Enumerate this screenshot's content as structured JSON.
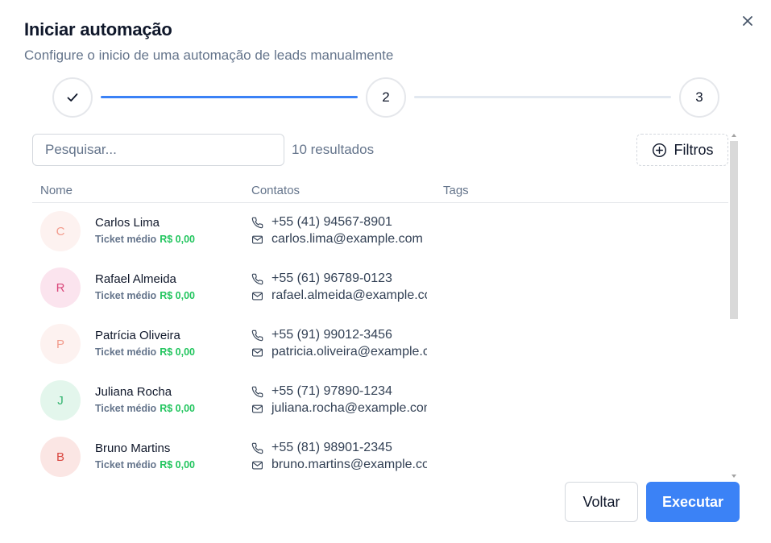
{
  "dialog": {
    "title": "Iniciar automação",
    "subtitle": "Configure o inicio de uma automação de leads manualmente"
  },
  "stepper": {
    "steps": [
      {
        "label": "",
        "state": "completed",
        "icon": "check-icon"
      },
      {
        "label": "2",
        "state": "current"
      },
      {
        "label": "3",
        "state": "upcoming"
      }
    ],
    "active_color": "#3b82f6",
    "inactive_color": "#e2e8f0"
  },
  "toolbar": {
    "search_placeholder": "Pesquisar...",
    "results_text": "10 resultados",
    "filters_label": "Filtros"
  },
  "table": {
    "columns": [
      "Nome",
      "Contatos",
      "Tags"
    ],
    "ticket_label": "Ticket médio",
    "rows": [
      {
        "initial": "C",
        "name": "Carlos Lima",
        "ticket": "R$ 0,00",
        "phone": "+55 (41) 94567-8901",
        "email": "carlos.lima@example.com",
        "avatar_bg": "#fdf2f0",
        "avatar_fg": "#f29b8c"
      },
      {
        "initial": "R",
        "name": "Rafael Almeida",
        "ticket": "R$ 0,00",
        "phone": "+55 (61) 96789-0123",
        "email": "rafael.almeida@example.com",
        "avatar_bg": "#fbe4ee",
        "avatar_fg": "#d9467a"
      },
      {
        "initial": "P",
        "name": "Patrícia Oliveira",
        "ticket": "R$ 0,00",
        "phone": "+55 (91) 99012-3456",
        "email": "patricia.oliveira@example.com",
        "avatar_bg": "#fdf2f0",
        "avatar_fg": "#f29b8c"
      },
      {
        "initial": "J",
        "name": "Juliana Rocha",
        "ticket": "R$ 0,00",
        "phone": "+55 (71) 97890-1234",
        "email": "juliana.rocha@example.com",
        "avatar_bg": "#e3f6ec",
        "avatar_fg": "#2fb26d"
      },
      {
        "initial": "B",
        "name": "Bruno Martins",
        "ticket": "R$ 0,00",
        "phone": "+55 (81) 98901-2345",
        "email": "bruno.martins@example.com",
        "avatar_bg": "#fbe6e4",
        "avatar_fg": "#d9463f"
      }
    ]
  },
  "footer": {
    "back_label": "Voltar",
    "run_label": "Executar",
    "run_color": "#3b82f6"
  }
}
